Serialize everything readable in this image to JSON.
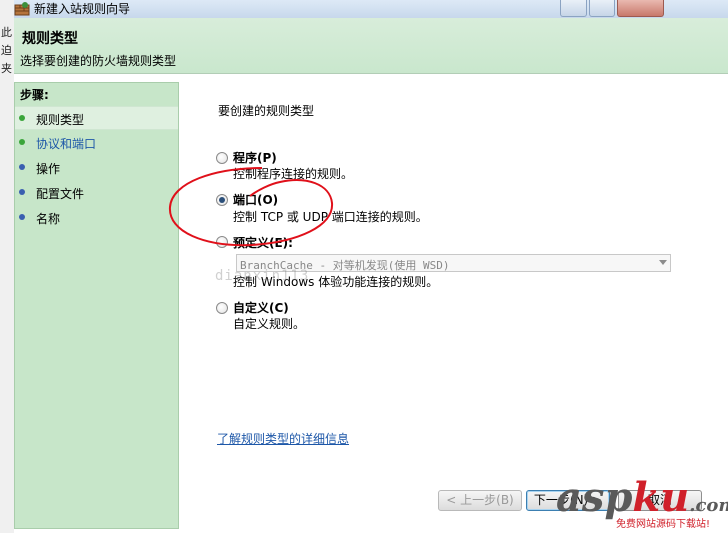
{
  "window": {
    "title": "新建入站规则向导"
  },
  "header": {
    "title": "规则类型",
    "subtitle": "选择要创建的防火墙规则类型"
  },
  "sidebar": {
    "steps_label": "步骤:",
    "items": [
      {
        "label": "规则类型",
        "dot_color": "#3aa53a"
      },
      {
        "label": "协议和端口",
        "dot_color": "#3aa53a"
      },
      {
        "label": "操作",
        "dot_color": "#3a5fb0"
      },
      {
        "label": "配置文件",
        "dot_color": "#3a5fb0"
      },
      {
        "label": "名称",
        "dot_color": "#3a5fb0"
      }
    ]
  },
  "main": {
    "question": "要创建的规则类型",
    "options": [
      {
        "title": "程序(P)",
        "description": "控制程序连接的规则。",
        "selected": false
      },
      {
        "title": "端口(O)",
        "description": "控制 TCP 或 UDP 端口连接的规则。",
        "selected": true
      },
      {
        "title": "预定义(E):",
        "description": "控制 Windows 体验功能连接的规则。",
        "selected": false
      },
      {
        "title": "自定义(C)",
        "description": "自定义规则。",
        "selected": false
      }
    ],
    "predefined_dropdown": {
      "value": "BranchCache - 对等机发现(使用 WSD)"
    },
    "learn_more_link": "了解规则类型的详细信息"
  },
  "buttons": {
    "back": "< 上一步(B)",
    "next": "下一步(N) >",
    "cancel": "取消"
  },
  "watermark": {
    "faint_text": "dianxin113",
    "logo_a": "asp",
    "logo_b": "ku",
    "logo_c": ".com",
    "sub": "免费网站源码下载站!"
  },
  "colors": {
    "accent_green": "#c7e6c9",
    "annotation_red": "#e0101a",
    "link_blue": "#1d57a8"
  }
}
